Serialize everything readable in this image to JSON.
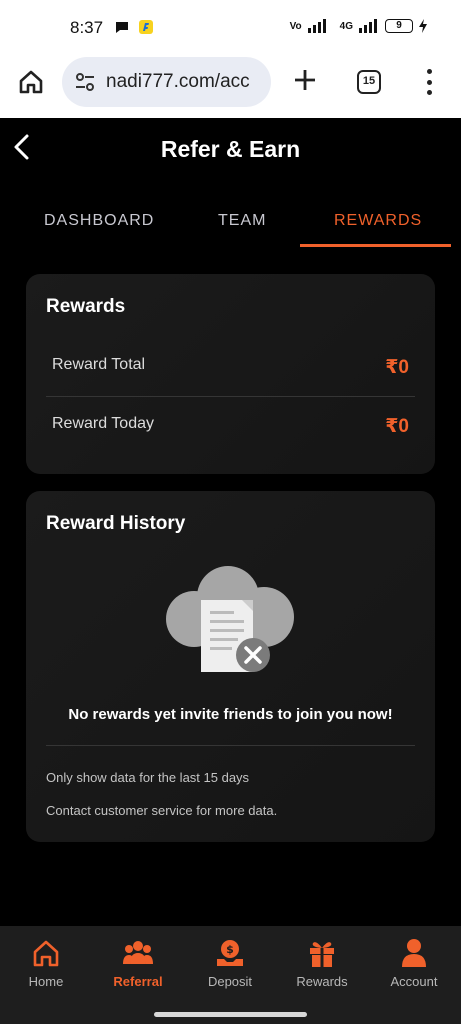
{
  "status_bar": {
    "time": "8:37",
    "network": "4G",
    "battery": "9"
  },
  "browser": {
    "url": "nadi777.com/acc",
    "tab_count": "15"
  },
  "header": {
    "title": "Refer & Earn"
  },
  "tabs": [
    {
      "label": "DASHBOARD",
      "active": false
    },
    {
      "label": "TEAM",
      "active": false
    },
    {
      "label": "REWARDS",
      "active": true
    }
  ],
  "rewards_card": {
    "title": "Rewards",
    "rows": [
      {
        "label": "Reward Total",
        "value": "₹0"
      },
      {
        "label": "Reward Today",
        "value": "₹0"
      }
    ]
  },
  "history_card": {
    "title": "Reward History",
    "empty_message": "No rewards yet invite friends to join you now!",
    "notes": [
      "Only show data for the last 15 days",
      "Contact customer service for more data."
    ]
  },
  "bottom_nav": [
    {
      "label": "Home",
      "icon": "home-icon",
      "active": false
    },
    {
      "label": "Referral",
      "icon": "group-icon",
      "active": true
    },
    {
      "label": "Deposit",
      "icon": "deposit-icon",
      "active": false
    },
    {
      "label": "Rewards",
      "icon": "gift-icon",
      "active": false
    },
    {
      "label": "Account",
      "icon": "person-icon",
      "active": false
    }
  ],
  "colors": {
    "accent": "#f0612b",
    "background": "#000000",
    "card": "#1b1b1b",
    "nav_background": "#1e1e1e"
  }
}
